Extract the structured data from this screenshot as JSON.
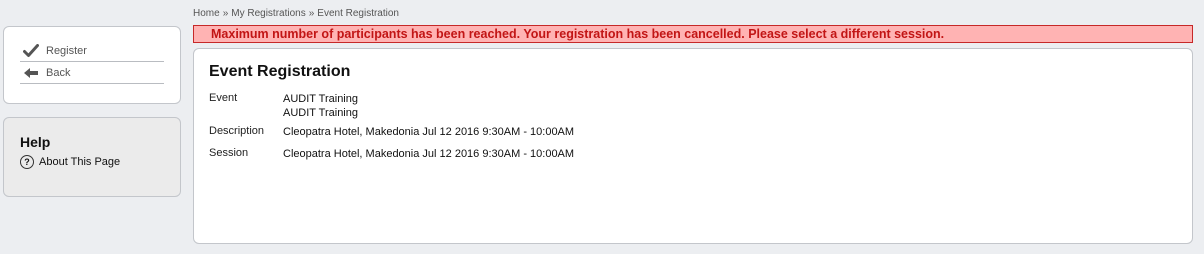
{
  "actions": {
    "register_label": "Register",
    "back_label": "Back"
  },
  "help": {
    "title": "Help",
    "about_label": "About This Page"
  },
  "breadcrumb": {
    "home": "Home",
    "separator": "»",
    "my_registrations": "My Registrations",
    "current": "Event Registration"
  },
  "error": {
    "message": "Maximum number of participants has been reached. Your registration has been cancelled. Please select a different session."
  },
  "main": {
    "title": "Event Registration",
    "event_label": "Event",
    "event_value_line1": "AUDIT Training",
    "event_value_line2": "AUDIT Training",
    "description_label": "Description",
    "description_value": "Cleopatra Hotel, Makedonia Jul 12 2016 9:30AM - 10:00AM",
    "session_label": "Session",
    "session_value": "Cleopatra Hotel, Makedonia Jul 12 2016 9:30AM - 10:00AM"
  },
  "colors": {
    "error_background": "#ffb3b3",
    "error_border": "#c62828",
    "error_text": "#c21515",
    "page_background": "#eceef1"
  },
  "icons": {
    "register": "checkmark-icon",
    "back": "arrow-left-icon",
    "help_link": "question-circle-icon"
  }
}
